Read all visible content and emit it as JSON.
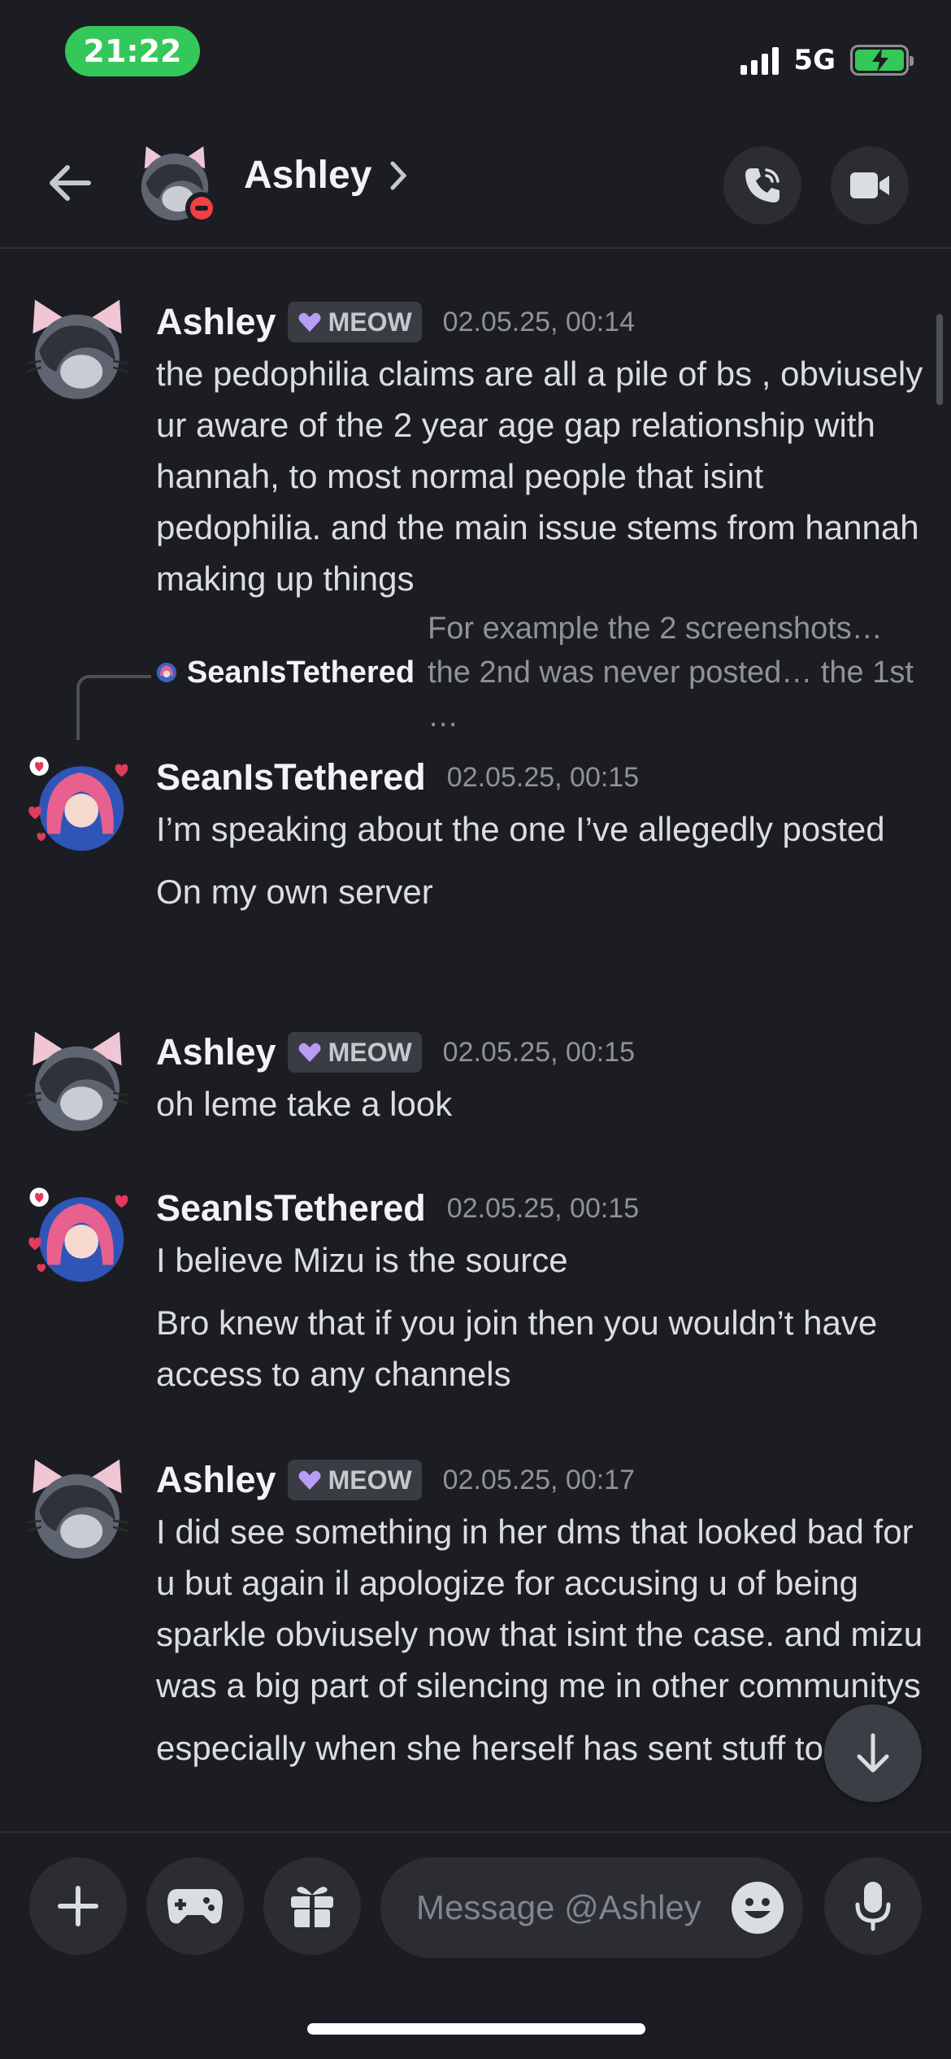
{
  "status_bar": {
    "time": "21:22",
    "network": "5G"
  },
  "header": {
    "name": "Ashley"
  },
  "messages": [
    {
      "author": "Ashley",
      "tag": "MEOW",
      "timestamp": "02.05.25, 00:14",
      "lines": [
        "the pedophilia claims are all a pile of bs  , obviusely ur aware of the 2 year age gap relationship with hannah, to most normal people that isint pedophilia.  and the main issue stems from hannah making up things"
      ]
    },
    {
      "reply": {
        "author": "SeanIsTethered",
        "text": "For example the 2 screenshots… the 2nd was never posted… the 1st …"
      },
      "author": "SeanIsTethered",
      "timestamp": "02.05.25, 00:15",
      "lines": [
        "I’m speaking about the one I’ve allegedly posted",
        "On my own server"
      ]
    },
    {
      "author": "Ashley",
      "tag": "MEOW",
      "timestamp": "02.05.25, 00:15",
      "lines": [
        "oh leme take a look"
      ]
    },
    {
      "author": "SeanIsTethered",
      "timestamp": "02.05.25, 00:15",
      "lines": [
        "I believe Mizu is the source",
        "Bro knew that if you join then you wouldn’t have access to any channels"
      ]
    },
    {
      "author": "Ashley",
      "tag": "MEOW",
      "timestamp": "02.05.25, 00:17",
      "lines": [
        "I did see something in her dms that looked bad for u but again il apologize for accusing u of being sparkle obviusely now that isint the case. and mizu was a big part of silencing me in other communitys",
        "especially when she herself has sent stuff to"
      ]
    }
  ],
  "composer": {
    "placeholder": "Message @Ashley"
  },
  "colors": {
    "background": "#1c1d22",
    "surface": "#2b2d33",
    "time_pill": "#34c759",
    "dnd": "#f23f43"
  },
  "icons": [
    "back-arrow-icon",
    "chevron-right-icon",
    "phone-icon",
    "video-camera-icon",
    "plus-icon",
    "gamepad-icon",
    "gift-icon",
    "emoji-icon",
    "microphone-icon",
    "arrow-down-icon",
    "heart-gem-icon"
  ]
}
